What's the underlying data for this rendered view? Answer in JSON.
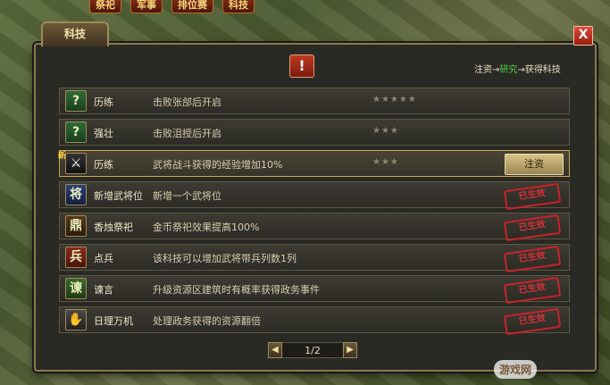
{
  "top_menu": [
    "祭祀",
    "军事",
    "排位赛",
    "科技"
  ],
  "window": {
    "tab_title": "科技",
    "close_label": "X",
    "alert_symbol": "!",
    "flow": {
      "part1": "注资→",
      "part2": "研究",
      "part3": "→获得科技"
    }
  },
  "tech_list": [
    {
      "icon": "question-icon",
      "icon_glyph": "?",
      "name": "历练",
      "desc": "击败张郃后开启",
      "stars": "★★★★★",
      "status": "locked"
    },
    {
      "icon": "question-icon",
      "icon_glyph": "?",
      "name": "强壮",
      "desc": "击败沮授后开启",
      "stars": "★★★",
      "status": "locked"
    },
    {
      "icon": "swordsman-icon",
      "icon_glyph": "⚔",
      "new_tag": "新",
      "name": "历练",
      "desc": "武将战斗获得的经验增加10%",
      "stars": "★★★",
      "status": "invest",
      "button": "注资"
    },
    {
      "icon": "general-icon",
      "icon_glyph": "将",
      "name": "新增武将位",
      "desc": "新增一个武将位",
      "status": "done",
      "stamp": "已生效"
    },
    {
      "icon": "incense-cup-icon",
      "icon_glyph": "鼎",
      "name": "香烛祭祀",
      "desc": "金币祭祀效果提高100%",
      "status": "done",
      "stamp": "已生效"
    },
    {
      "icon": "soldier-icon",
      "icon_glyph": "兵",
      "name": "点兵",
      "desc": "该科技可以增加武将带兵列数1列",
      "status": "done",
      "stamp": "已生效"
    },
    {
      "icon": "scroll-icon",
      "icon_glyph": "谏",
      "name": "谏言",
      "desc": "升级资源区建筑时有概率获得政务事件",
      "status": "done",
      "stamp": "已生效"
    },
    {
      "icon": "hand-icon",
      "icon_glyph": "✋",
      "name": "日理万机",
      "desc": "处理政务获得的资源翻倍",
      "status": "done",
      "stamp": "已生效"
    }
  ],
  "pagination": {
    "prev": "◀",
    "page": "1/2",
    "next": "▶"
  },
  "watermark": "游戏网"
}
